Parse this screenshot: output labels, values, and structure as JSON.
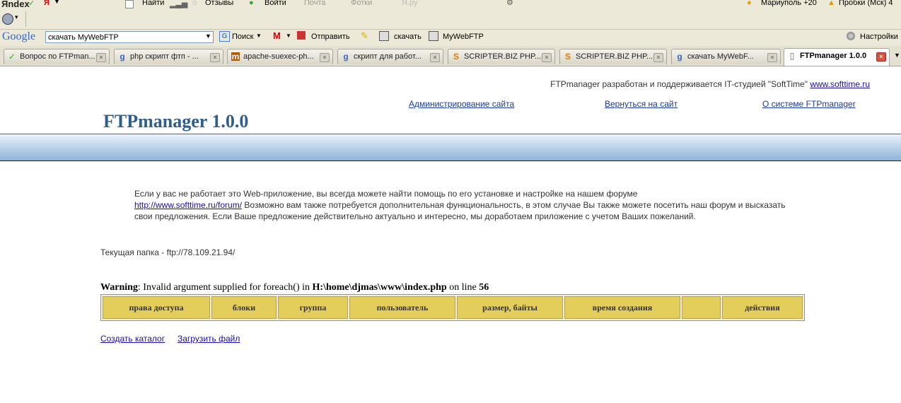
{
  "toolbar1": {
    "yandex_brand": "Яndex",
    "find_label": "Найти",
    "reviews_label": "Отзывы",
    "login_label": "Войти",
    "mail_label": "Почта",
    "photos_label": "Фотки",
    "yaru_label": "Я.ру",
    "weather": "Мариуполь +20",
    "traffic": "Пробки (Мск) 4"
  },
  "google_toolbar": {
    "brand": "Google",
    "search_value": "скачать MyWebFTP",
    "search_btn": "Поиск",
    "send_btn": "Отправить",
    "highlight_word": "скачать",
    "highlight_word2": "MyWebFTP",
    "settings": "Настройки"
  },
  "tabs": [
    {
      "label": "Вопрос по FTPman...",
      "icon": "✓"
    },
    {
      "label": "php скрипт фтп - ...",
      "icon": "g"
    },
    {
      "label": "apache-suexec-ph...",
      "icon": "m"
    },
    {
      "label": "скрипт для работ...",
      "icon": "g"
    },
    {
      "label": "SCRIPTER.BIZ PHP...",
      "icon": "S"
    },
    {
      "label": "SCRIPTER.BIZ PHP...",
      "icon": "S"
    },
    {
      "label": "скачать MyWebF...",
      "icon": "g"
    },
    {
      "label": "FTPmanager 1.0.0",
      "icon": "▯"
    }
  ],
  "page": {
    "credit_text": "FTPmanager разработан и поддерживается IT-студией \"SoftTime\"",
    "credit_link": "www.softtime.ru",
    "nav": {
      "admin": "Администрирование сайта",
      "back": "Вернуться на сайт",
      "about": "О системе FTPmanager"
    },
    "logo": "FTPmanager 1.0.0",
    "intro_part1": "Если у вас не работает это Web-приложение, вы всегда можете найти помощь по его установке и настройке на нашем форуме",
    "forum_link": "http://www.softtime.ru/forum/",
    "intro_part2": " Возможно вам также потребуется дополнительная функциональность, в этом случае Вы также можете посетить наш форум и высказать свои предложения. Если Ваше предложение действительно актуально и интересно, мы доработаем приложение с учетом Ваших пожеланий.",
    "current_folder": "Текущая папка - ftp://78.109.21.94/",
    "warning": {
      "label": "Warning",
      "text1": ": Invalid argument supplied for foreach() in ",
      "path": "H:\\home\\djmas\\www\\index.php",
      "text2": " on line ",
      "line": "56"
    },
    "table_headers": [
      "права доступа",
      "блоки",
      "группа",
      "пользователь",
      "размер, байты",
      "время создания",
      "",
      "действия"
    ],
    "create_dir": "Создать каталог",
    "upload_file": "Загрузить файл"
  },
  "colors": {
    "header_cell": "#e3cd5b",
    "logo": "#2f5e8e",
    "band": "#b7cfe8"
  }
}
